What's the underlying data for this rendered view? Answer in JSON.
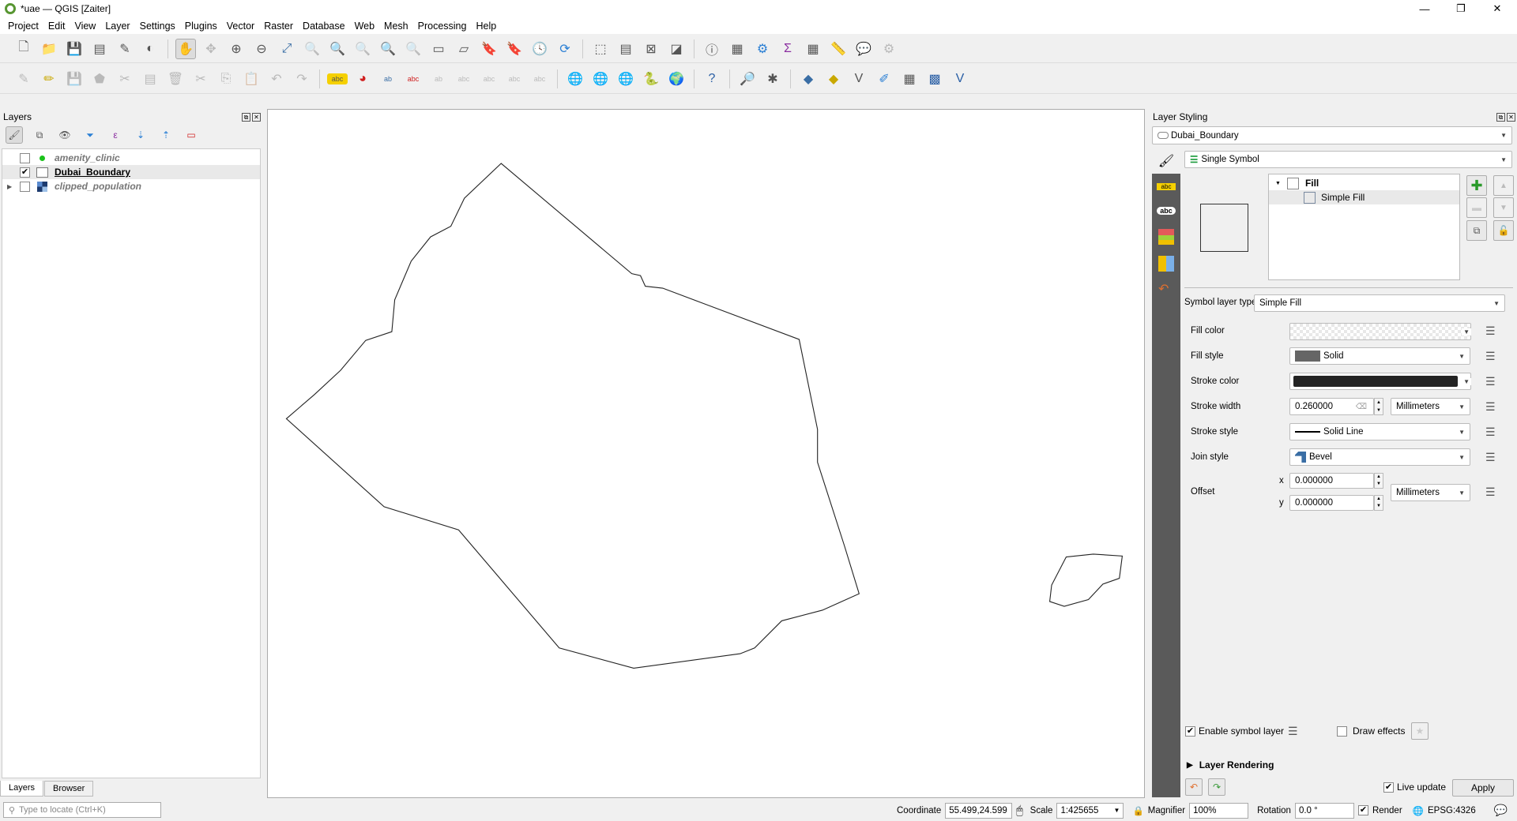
{
  "window": {
    "title": "*uae — QGIS [Zaiter]",
    "minimize": "—",
    "maximize": "❐",
    "close": "✕"
  },
  "menu": [
    "Project",
    "Edit",
    "View",
    "Layer",
    "Settings",
    "Plugins",
    "Vector",
    "Raster",
    "Database",
    "Web",
    "Mesh",
    "Processing",
    "Help"
  ],
  "layers_panel": {
    "title": "Layers",
    "layers": [
      {
        "name": "amenity_clinic",
        "checked": false
      },
      {
        "name": "Dubai_Boundary",
        "checked": true
      },
      {
        "name": "clipped_population",
        "checked": false
      }
    ],
    "tabs": [
      "Layers",
      "Browser"
    ]
  },
  "locator": {
    "placeholder": "Type to locate (Ctrl+K)"
  },
  "styling": {
    "title": "Layer Styling",
    "layer": "Dubai_Boundary",
    "renderer": "Single Symbol",
    "tree": {
      "root": "Fill",
      "child": "Simple Fill"
    },
    "symbol_layer_type_label": "Symbol layer type",
    "symbol_layer_type": "Simple Fill",
    "fields": {
      "fill_color": "Fill color",
      "fill_style": "Fill style",
      "fill_style_value": "Solid",
      "stroke_color": "Stroke color",
      "stroke_color_value": "#232323",
      "stroke_width": "Stroke width",
      "stroke_width_value": "0.260000",
      "stroke_width_unit": "Millimeters",
      "stroke_style": "Stroke style",
      "stroke_style_value": "Solid Line",
      "join_style": "Join style",
      "join_style_value": "Bevel",
      "offset": "Offset",
      "offset_x_label": "x",
      "offset_x": "0.000000",
      "offset_y_label": "y",
      "offset_y": "0.000000",
      "offset_unit": "Millimeters"
    },
    "enable_symbol_layer": "Enable symbol layer",
    "draw_effects": "Draw effects",
    "layer_rendering": "Layer Rendering",
    "live_update": "Live update",
    "apply": "Apply"
  },
  "status": {
    "coordinate_label": "Coordinate",
    "coordinate": "55.499,24.599",
    "scale_label": "Scale",
    "scale": "1:425655",
    "magnifier_label": "Magnifier",
    "magnifier": "100%",
    "rotation_label": "Rotation",
    "rotation": "0.0 °",
    "render": "Render",
    "crs": "EPSG:4326"
  }
}
